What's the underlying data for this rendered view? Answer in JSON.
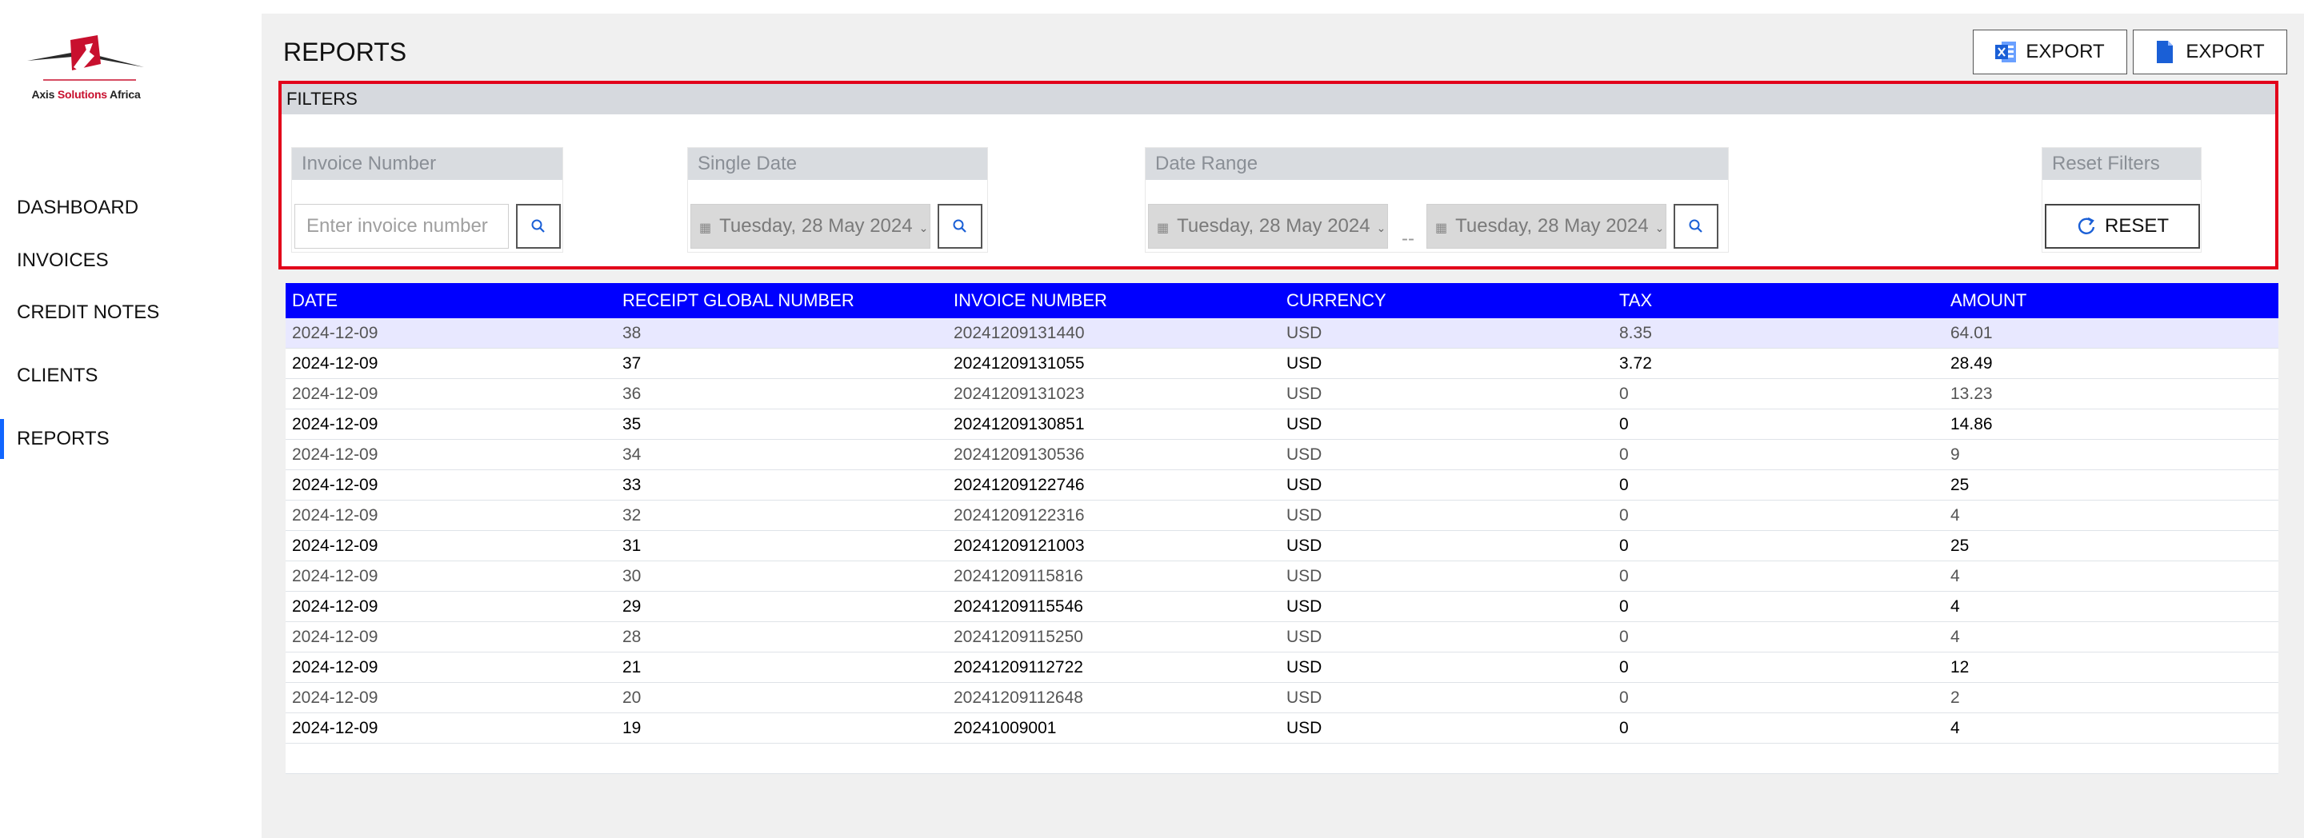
{
  "brand": {
    "logo_text_prefix": "Axis ",
    "logo_text_accent": "Solutions",
    "logo_text_suffix": " Africa",
    "accent": "#c8102e"
  },
  "sidebar": {
    "items": [
      {
        "label": "DASHBOARD",
        "active": false
      },
      {
        "label": "INVOICES",
        "active": false
      },
      {
        "label": "CREDIT NOTES",
        "active": false
      },
      {
        "label": "CLIENTS",
        "active": false
      },
      {
        "label": "REPORTS",
        "active": true
      }
    ]
  },
  "header": {
    "title": "REPORTS",
    "export_excel_label": "EXPORT",
    "export_pdf_label": "EXPORT"
  },
  "filters": {
    "title": "FILTERS",
    "invoice_number": {
      "label": "Invoice Number",
      "placeholder": "Enter invoice number"
    },
    "single_date": {
      "label": "Single Date",
      "value": "Tuesday, 28 May 2024"
    },
    "date_range": {
      "label": "Date Range",
      "from": "Tuesday, 28 May 2024",
      "separator": "--",
      "to": "Tuesday, 28 May 2024"
    },
    "reset": {
      "label": "Reset Filters",
      "button_label": "RESET"
    }
  },
  "table": {
    "columns": [
      "DATE",
      "RECEIPT GLOBAL NUMBER",
      "INVOICE NUMBER",
      "CURRENCY",
      "TAX",
      "AMOUNT"
    ],
    "rows": [
      [
        "2024-12-09",
        "38",
        "20241209131440",
        "USD",
        "8.35",
        "64.01"
      ],
      [
        "2024-12-09",
        "37",
        "20241209131055",
        "USD",
        "3.72",
        "28.49"
      ],
      [
        "2024-12-09",
        "36",
        "20241209131023",
        "USD",
        "0",
        "13.23"
      ],
      [
        "2024-12-09",
        "35",
        "20241209130851",
        "USD",
        "0",
        "14.86"
      ],
      [
        "2024-12-09",
        "34",
        "20241209130536",
        "USD",
        "0",
        "9"
      ],
      [
        "2024-12-09",
        "33",
        "20241209122746",
        "USD",
        "0",
        "25"
      ],
      [
        "2024-12-09",
        "32",
        "20241209122316",
        "USD",
        "0",
        "4"
      ],
      [
        "2024-12-09",
        "31",
        "20241209121003",
        "USD",
        "0",
        "25"
      ],
      [
        "2024-12-09",
        "30",
        "20241209115816",
        "USD",
        "0",
        "4"
      ],
      [
        "2024-12-09",
        "29",
        "20241209115546",
        "USD",
        "0",
        "4"
      ],
      [
        "2024-12-09",
        "28",
        "20241209115250",
        "USD",
        "0",
        "4"
      ],
      [
        "2024-12-09",
        "21",
        "20241209112722",
        "USD",
        "0",
        "12"
      ],
      [
        "2024-12-09",
        "20",
        "20241209112648",
        "USD",
        "0",
        "2"
      ],
      [
        "2024-12-09",
        "19",
        "20241009001",
        "USD",
        "0",
        "4"
      ]
    ]
  },
  "colors": {
    "table_header_bg": "#0000ff",
    "filters_border": "#e2001a",
    "active_nav_indicator": "#1166ff",
    "excel_icon": "#1a5fd6",
    "pdf_icon": "#1a5fd6"
  }
}
